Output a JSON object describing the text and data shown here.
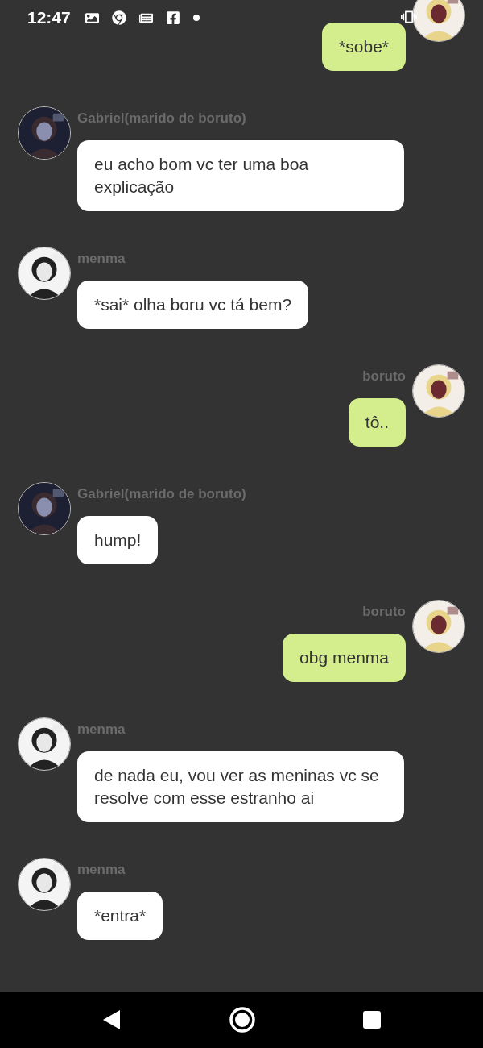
{
  "status_bar": {
    "time": "12:47"
  },
  "messages": [
    {
      "kind": "sent",
      "text": "*sobe*"
    },
    {
      "kind": "received",
      "name": "Gabriel(marido de boruto)",
      "text": "eu acho bom vc ter uma boa explicação"
    },
    {
      "kind": "received",
      "name": "menma",
      "text": "*sai* olha boru vc tá bem?"
    },
    {
      "kind": "sent",
      "name": "boruto",
      "text": "tô.."
    },
    {
      "kind": "received",
      "name": "Gabriel(marido de boruto)",
      "text": "hump!"
    },
    {
      "kind": "sent",
      "name": "boruto",
      "text": "obg menma"
    },
    {
      "kind": "received",
      "name": "menma",
      "text": "de nada eu, vou ver as meninas vc se resolve com esse estranho ai"
    },
    {
      "kind": "received",
      "name": "menma",
      "text": "*entra*"
    }
  ]
}
